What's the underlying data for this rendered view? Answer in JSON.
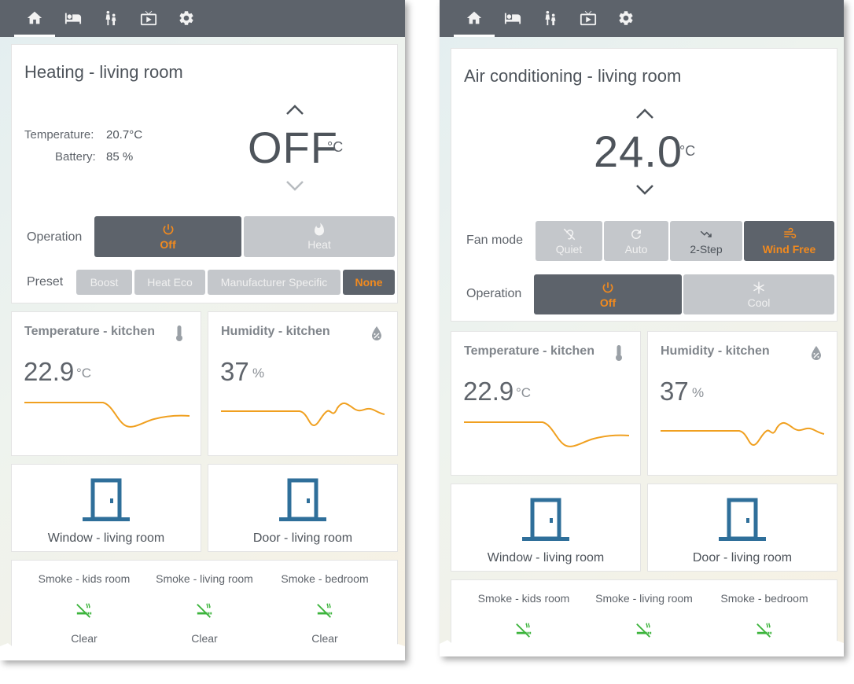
{
  "nav_icons": [
    "home-icon",
    "bed-icon",
    "family-icon",
    "tv-icon",
    "gear-icon"
  ],
  "colors": {
    "header": "#5d636b",
    "accent": "#f28a1e",
    "icon_blue": "#2f6f9a",
    "ok_green": "#3cb43c"
  },
  "left": {
    "heating": {
      "title": "Heating - living room",
      "temperature_label": "Temperature:",
      "temperature_value": "20.7°C",
      "battery_label": "Battery:",
      "battery_value": "85 %",
      "setpoint": "OFF",
      "unit": "°C",
      "operation_label": "Operation",
      "operation_buttons": [
        {
          "label": "Off",
          "icon": "power-icon",
          "active": true
        },
        {
          "label": "Heat",
          "icon": "flame-icon",
          "active": false
        }
      ],
      "preset_label": "Preset",
      "preset_buttons": [
        {
          "label": "Boost",
          "active": false
        },
        {
          "label": "Heat Eco",
          "active": false
        },
        {
          "label": "Manufacturer Specific",
          "active": false
        },
        {
          "label": "None",
          "active": true
        }
      ]
    }
  },
  "right": {
    "ac": {
      "title": "Air conditioning - living room",
      "setpoint": "24.0",
      "unit": "°C",
      "fan_mode_label": "Fan mode",
      "fan_buttons": [
        {
          "label": "Quiet",
          "icon": "ear-off-icon",
          "active": false
        },
        {
          "label": "Auto",
          "icon": "refresh-icon",
          "active": false
        },
        {
          "label": "2-Step",
          "icon": "trend-down-icon",
          "active": false
        },
        {
          "label": "Wind Free",
          "icon": "wind-icon",
          "active": true
        }
      ],
      "operation_label": "Operation",
      "operation_buttons": [
        {
          "label": "Off",
          "icon": "power-icon",
          "active": true
        },
        {
          "label": "Cool",
          "icon": "snowflake-icon",
          "active": false
        }
      ]
    }
  },
  "sensors": {
    "temperature": {
      "title": "Temperature - kitchen",
      "value": "22.9",
      "unit": "°C",
      "icon": "thermometer-icon"
    },
    "humidity": {
      "title": "Humidity - kitchen",
      "value": "37",
      "unit": "%",
      "icon": "water-percent-icon"
    }
  },
  "doors": {
    "window": "Window - living room",
    "door": "Door - living room"
  },
  "smoke": [
    {
      "label": "Smoke - kids room",
      "state": "Clear"
    },
    {
      "label": "Smoke - living room",
      "state": "Clear"
    },
    {
      "label": "Smoke - bedroom",
      "state": "Clear"
    }
  ]
}
